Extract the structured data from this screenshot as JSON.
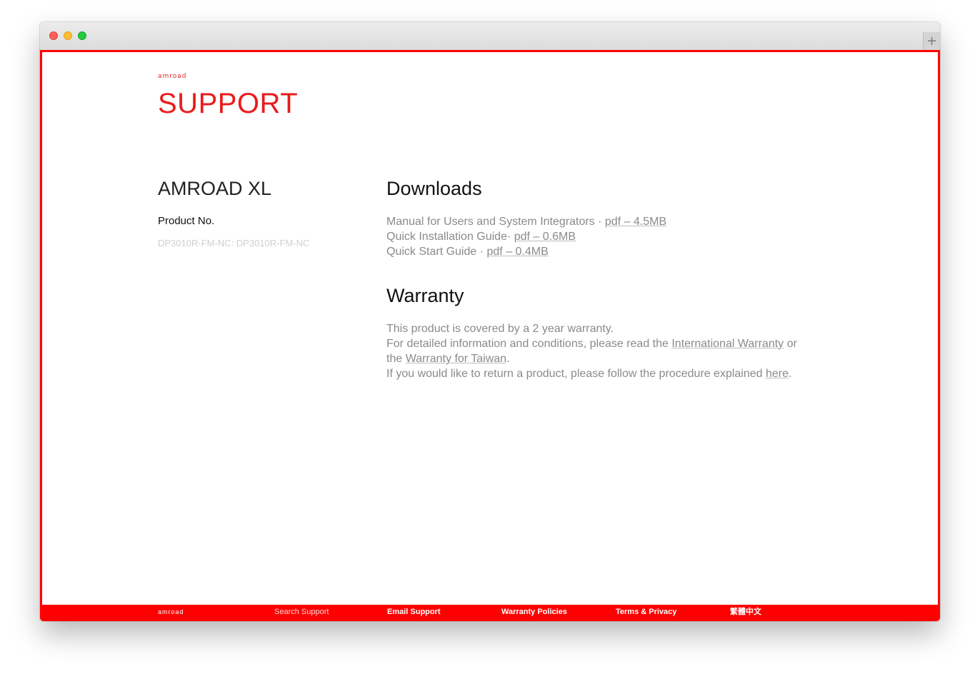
{
  "window": {
    "new_tab_symbol": "+"
  },
  "brand": {
    "name": "amroad",
    "accent_color": "#ff0000"
  },
  "page": {
    "title": "SUPPORT"
  },
  "product": {
    "name": "AMROAD XL",
    "number_label": "Product No.",
    "number_value": "DP3010R-FM-NC: DP3010R-FM-NC"
  },
  "downloads": {
    "title": "Downloads",
    "items": [
      {
        "label": "Manual for Users and System Integrators · ",
        "link": "pdf – 4.5MB"
      },
      {
        "label": "Quick Installation Guide· ",
        "link": "pdf – 0.6MB"
      },
      {
        "label": "Quick Start Guide · ",
        "link": "pdf – 0.4MB"
      }
    ]
  },
  "warranty": {
    "title": "Warranty",
    "line1": "This product is covered by a 2 year warranty.",
    "line2_prefix": "For detailed information and conditions, please read the ",
    "line2_link": "International Warranty",
    "line2_suffix": " or",
    "line3_prefix": "the ",
    "line3_link": "Warranty for Taiwan",
    "line3_suffix": ".",
    "line4_prefix": "If you would like to return a product, please follow the procedure explained ",
    "line4_link": "here",
    "line4_suffix": "."
  },
  "footer": {
    "logo": "amroad",
    "search": "Search Support",
    "email": "Email Support",
    "warranty": "Warranty Policies",
    "terms": "Terms & Privacy",
    "language": "繁體中文"
  }
}
